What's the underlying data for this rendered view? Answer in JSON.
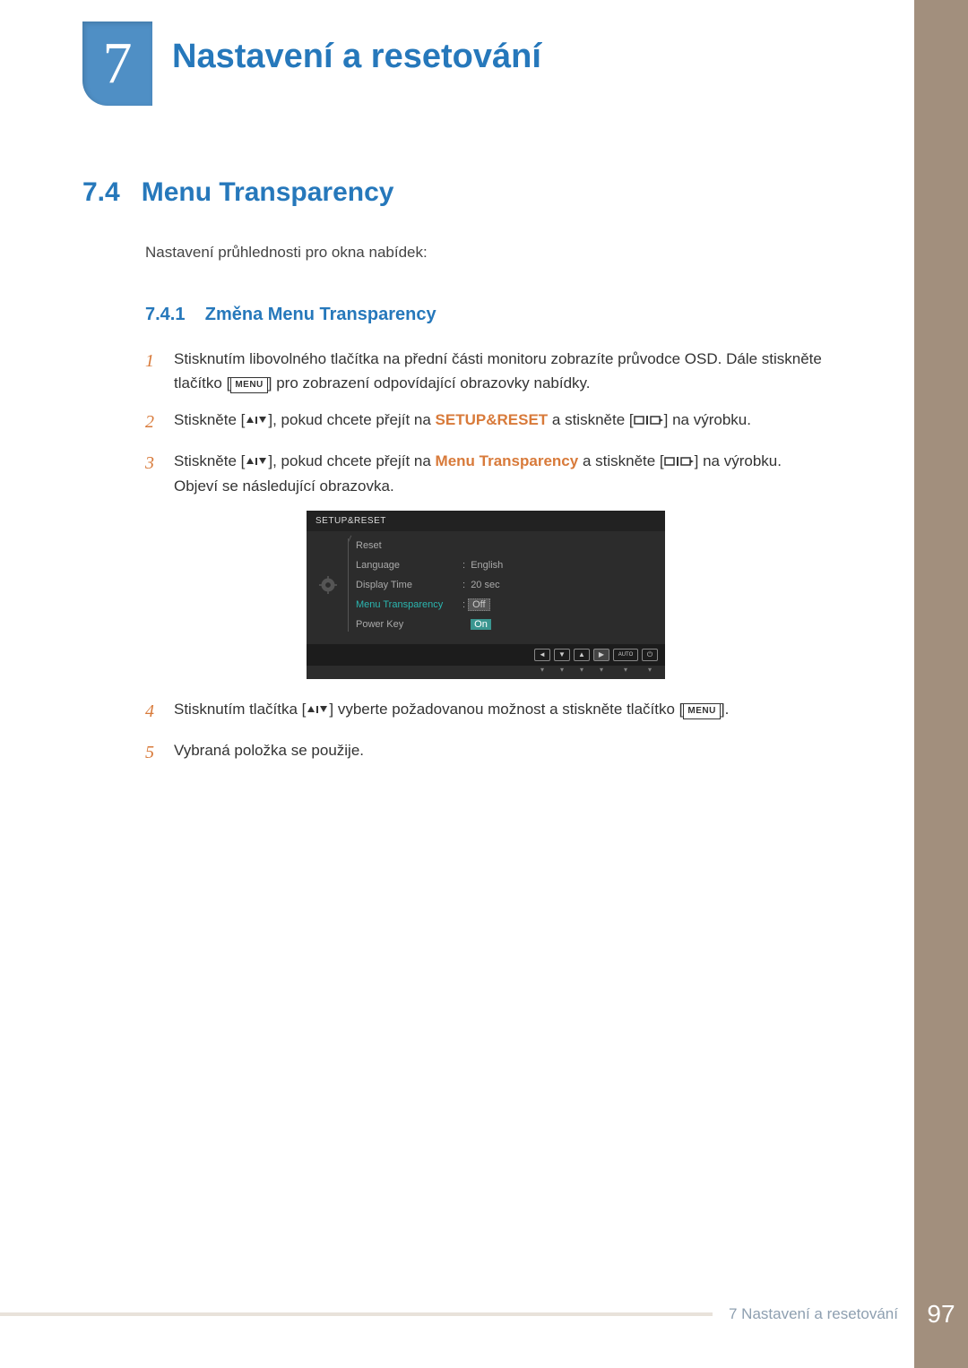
{
  "chapter": {
    "number": "7",
    "title": "Nastavení a resetování"
  },
  "section": {
    "number": "7.4",
    "title": "Menu Transparency",
    "intro": "Nastavení průhlednosti pro okna nabídek:"
  },
  "subsection": {
    "number": "7.4.1",
    "title": "Změna Menu Transparency"
  },
  "steps": {
    "s1_a": "Stisknutím libovolného tlačítka na přední části monitoru zobrazíte průvodce OSD. Dále stiskněte tlačítko [",
    "s1_b": "] pro zobrazení odpovídající obrazovky nabídky.",
    "s2_a": "Stiskněte [",
    "s2_b": "], pokud chcete přejít na ",
    "s2_hl": "SETUP&RESET",
    "s2_c": " a stiskněte [",
    "s2_d": "] na výrobku.",
    "s3_a": "Stiskněte [",
    "s3_b": "], pokud chcete přejít na ",
    "s3_hl": "Menu Transparency",
    "s3_c": " a stiskněte [",
    "s3_d": "] na výrobku. Objeví se následující obrazovka.",
    "s4_a": "Stisknutím tlačítka [",
    "s4_b": "] vyberte požadovanou možnost a stiskněte tlačítko [",
    "s4_c": "].",
    "s5": "Vybraná položka se použije."
  },
  "nums": {
    "n1": "1",
    "n2": "2",
    "n3": "3",
    "n4": "4",
    "n5": "5"
  },
  "menu_key": "MENU",
  "osd": {
    "header": "SETUP&RESET",
    "labels": {
      "reset": "Reset",
      "language": "Language",
      "display_time": "Display Time",
      "menu_transparency": "Menu Transparency",
      "power_key": "Power Key"
    },
    "values": {
      "language": "English",
      "display_time": "20 sec",
      "off": "Off",
      "on": "On"
    },
    "sep": ":",
    "nav": {
      "left": "◄",
      "down": "▼",
      "up": "▲",
      "enter": "▶",
      "auto": "AUTO",
      "power": "⏻",
      "dot": "▾"
    }
  },
  "footer": {
    "text": "7 Nastavení a resetování",
    "page": "97"
  }
}
